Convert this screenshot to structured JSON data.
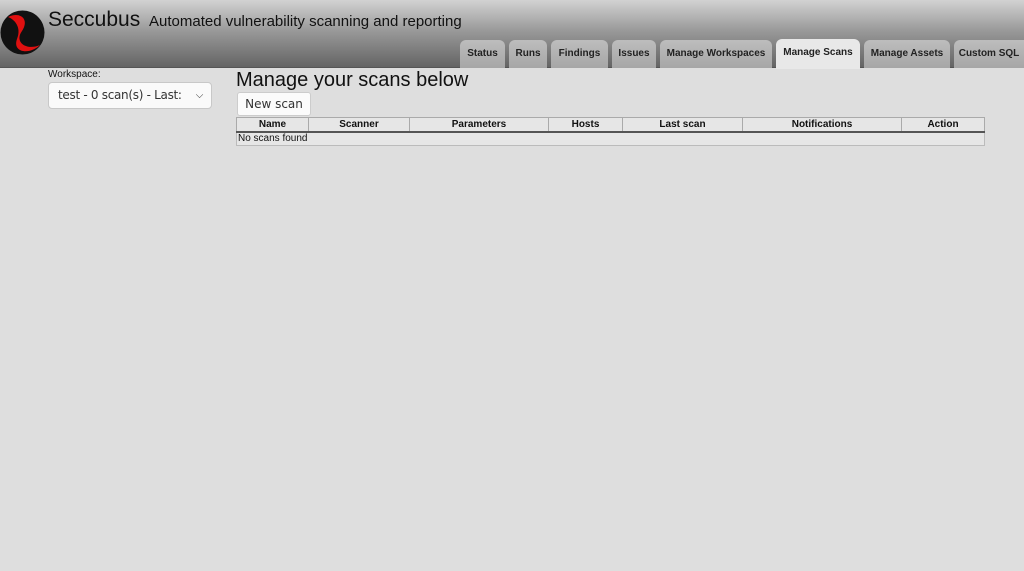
{
  "header": {
    "title": "Seccubus",
    "subtitle": "Automated vulnerability scanning and reporting",
    "logo_colors": {
      "red": "#e01010",
      "black": "#111111"
    }
  },
  "tabs": [
    {
      "label": "Status"
    },
    {
      "label": "Runs"
    },
    {
      "label": "Findings"
    },
    {
      "label": "Issues"
    },
    {
      "label": "Manage Workspaces"
    },
    {
      "label": "Manage Scans",
      "active": true
    },
    {
      "label": "Manage Assets"
    },
    {
      "label": "Custom SQL"
    }
  ],
  "sidebar": {
    "workspace_label": "Workspace:",
    "workspace_value": "test - 0 scan(s) - Last:"
  },
  "main": {
    "title": "Manage your scans below",
    "new_scan_label": "New scan",
    "table": {
      "columns": [
        "Name",
        "Scanner",
        "Parameters",
        "Hosts",
        "Last scan",
        "Notifications",
        "Action"
      ],
      "empty_text": "No scans found"
    }
  }
}
